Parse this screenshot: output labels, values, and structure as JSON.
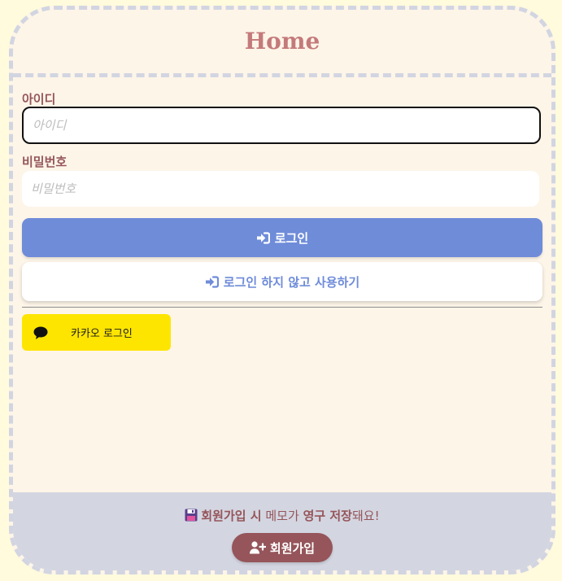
{
  "header": {
    "title": "Home"
  },
  "form": {
    "id_label": "아이디",
    "id_placeholder": "아이디",
    "id_value": "",
    "pw_label": "비밀번호",
    "pw_placeholder": "비밀번호",
    "pw_value": ""
  },
  "buttons": {
    "login_label": "로그인",
    "guest_label": "로그인 하지 않고 사용하기",
    "kakao_label": "카카오 로그인",
    "signup_label": "회원가입"
  },
  "footer": {
    "notice_part1": "회원가입 시",
    "notice_part2": "메모가",
    "notice_part3": "영구 저장",
    "notice_part4": "돼요!"
  },
  "icons": {
    "login": "sign-in-icon",
    "guest": "sign-in-icon",
    "kakao": "chat-bubble-icon",
    "notice": "floppy-disk-icon",
    "signup": "user-plus-icon"
  },
  "colors": {
    "page_background": "#fffbdc",
    "card_background": "#fdf5e8",
    "title": "#c47a7a",
    "label": "#95555a",
    "primary": "#6f8cd9",
    "kakao": "#fee500",
    "footer": "#d3d6e1",
    "signup": "#95555a"
  }
}
